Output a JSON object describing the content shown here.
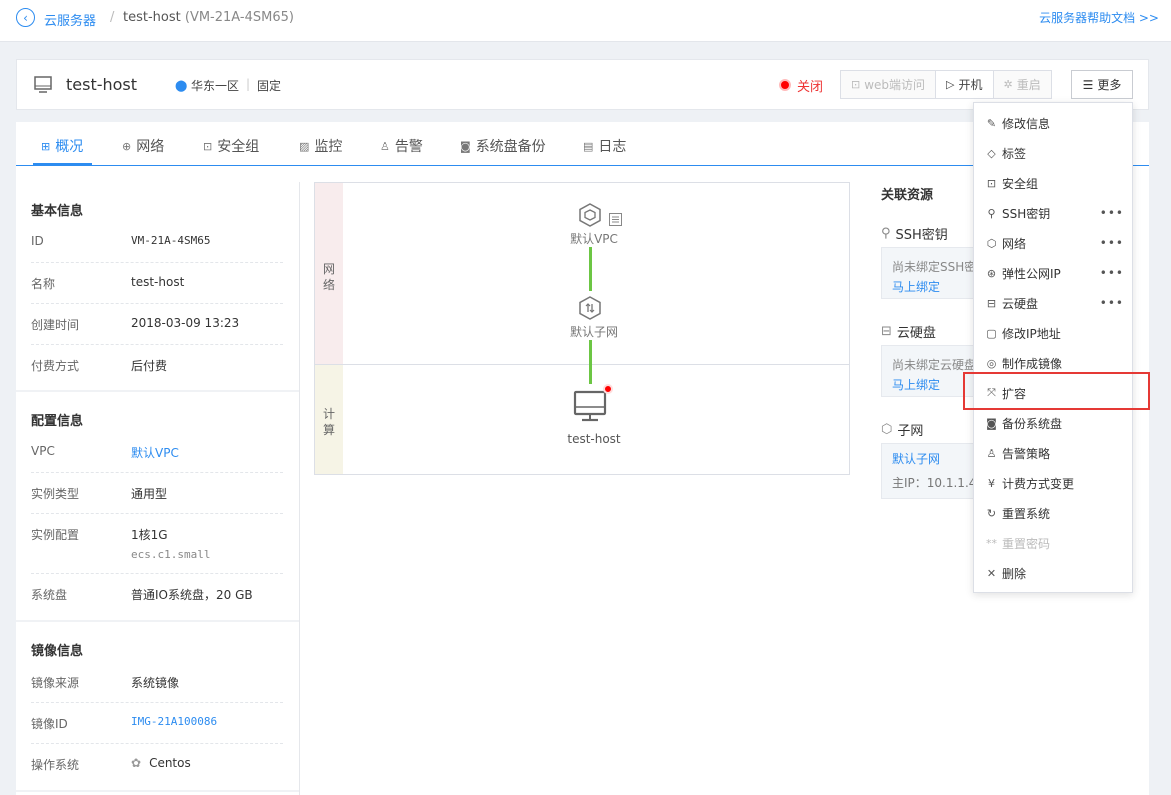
{
  "breadcrumb": {
    "root": "云服务器",
    "separator": "/",
    "current": "test-host",
    "current_sub": "(VM-21A-4SM65)",
    "help": "云服务器帮助文档 >>"
  },
  "header": {
    "name": "test-host",
    "region": "华东一区",
    "type": "固定",
    "status": "关闭",
    "buttons": {
      "web": "web端访问",
      "start": "开机",
      "restart": "重启",
      "more": "更多"
    }
  },
  "tabs": [
    "概况",
    "网络",
    "安全组",
    "监控",
    "告警",
    "系统盘备份",
    "日志"
  ],
  "basic": {
    "title": "基本信息",
    "rows": [
      {
        "k": "ID",
        "v": "VM-21A-4SM65"
      },
      {
        "k": "名称",
        "v": "test-host"
      },
      {
        "k": "创建时间",
        "v": "2018-03-09 13:23"
      },
      {
        "k": "付费方式",
        "v": "后付费"
      }
    ]
  },
  "config": {
    "title": "配置信息",
    "rows": [
      {
        "k": "VPC",
        "v": "默认VPC"
      },
      {
        "k": "实例类型",
        "v": "通用型"
      },
      {
        "k": "实例配置",
        "v": "1核1G",
        "v2": "ecs.c1.small"
      },
      {
        "k": "系统盘",
        "v": "普通IO系统盘，20 GB"
      }
    ]
  },
  "image": {
    "title": "镜像信息",
    "rows": [
      {
        "k": "镜像来源",
        "v": "系统镜像"
      },
      {
        "k": "镜像ID",
        "v": "IMG-21A100086"
      },
      {
        "k": "操作系统",
        "v": "Centos"
      }
    ]
  },
  "topology": {
    "lane_network": "网络",
    "lane_compute": "计算",
    "vpc": "默认VPC",
    "subnet": "默认子网",
    "host": "test-host"
  },
  "related": {
    "title": "关联资源",
    "ssh": {
      "title": "SSH密钥",
      "empty": "尚未绑定SSH密",
      "action": "马上绑定"
    },
    "disk": {
      "title": "云硬盘",
      "empty": "尚未绑定云硬盘",
      "action": "马上绑定"
    },
    "subnet": {
      "title": "子网",
      "name": "默认子网",
      "ip": "主IP：10.1.1.4"
    }
  },
  "menu": [
    {
      "label": "修改信息",
      "icon": "edit-icon"
    },
    {
      "label": "标签",
      "icon": "tag-icon"
    },
    {
      "label": "安全组",
      "icon": "lock-icon"
    },
    {
      "label": "SSH密钥",
      "icon": "key-icon",
      "more": "•••"
    },
    {
      "label": "网络",
      "icon": "network-icon",
      "more": "•••"
    },
    {
      "label": "弹性公网IP",
      "icon": "globe-icon",
      "more": "•••"
    },
    {
      "label": "云硬盘",
      "icon": "disk-icon",
      "more": "•••"
    },
    {
      "label": "修改IP地址",
      "icon": "ip-icon"
    },
    {
      "label": "制作成镜像",
      "icon": "image-icon"
    },
    {
      "label": "扩容",
      "icon": "expand-icon"
    },
    {
      "label": "备份系统盘",
      "icon": "backup-icon"
    },
    {
      "label": "告警策略",
      "icon": "bell-icon"
    },
    {
      "label": "计费方式变更",
      "icon": "yen-icon"
    },
    {
      "label": "重置系统",
      "icon": "refresh-icon"
    },
    {
      "label": "重置密码",
      "icon": "password-icon",
      "disabled": true
    },
    {
      "label": "删除",
      "icon": "close-icon"
    }
  ],
  "colors": {
    "accent": "#2d8cf0",
    "status": "#ee3333",
    "link_line": "#6cc644",
    "highlight": "#e53935"
  }
}
